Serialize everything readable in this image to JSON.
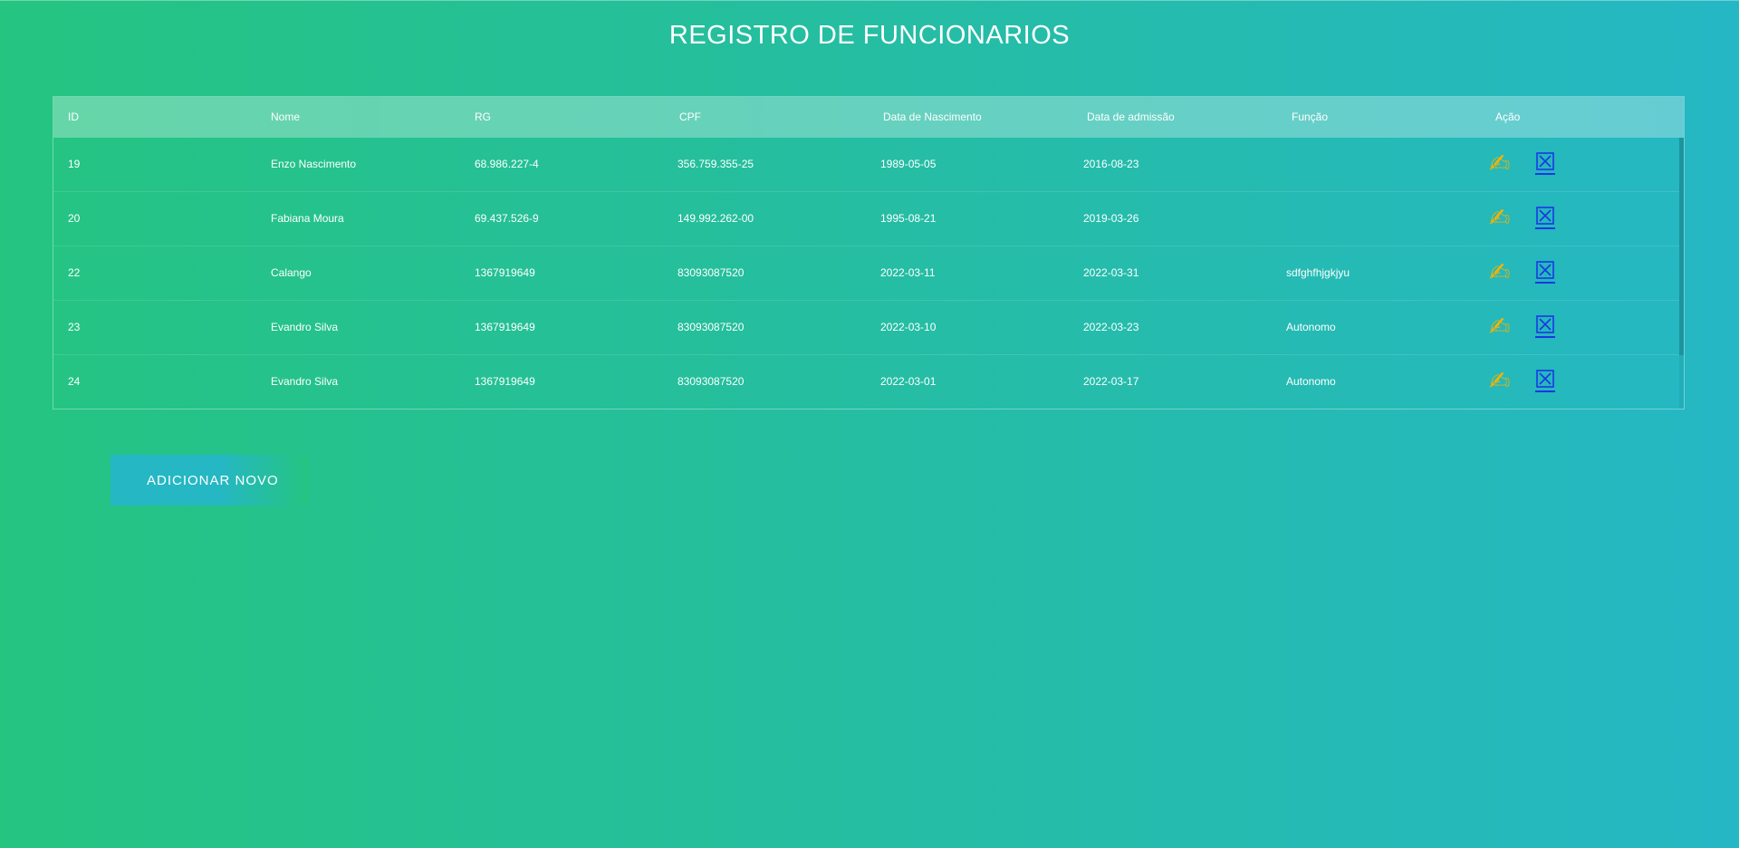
{
  "page": {
    "title": "REGISTRO DE FUNCIONARIOS"
  },
  "table": {
    "headers": [
      "ID",
      "Nome",
      "RG",
      "CPF",
      "Data de Nascimento",
      "Data de admissão",
      "Função",
      "Ação"
    ],
    "rows": [
      [
        "19",
        "Enzo Nascimento",
        "68.986.227-4",
        "356.759.355-25",
        "1989-05-05",
        "2016-08-23",
        ""
      ],
      [
        "20",
        "Fabiana Moura",
        "69.437.526-9",
        "149.992.262-00",
        "1995-08-21",
        "2019-03-26",
        ""
      ],
      [
        "22",
        "Calango",
        "1367919649",
        "83093087520",
        "2022-03-11",
        "2022-03-31",
        "sdfghfhjgkjyu"
      ],
      [
        "23",
        "Evandro Silva",
        "1367919649",
        "83093087520",
        "2022-03-10",
        "2022-03-23",
        "Autonomo"
      ],
      [
        "24",
        "Evandro Silva",
        "1367919649",
        "83093087520",
        "2022-03-01",
        "2022-03-17",
        "Autonomo"
      ]
    ],
    "actions": {
      "edit_icon": "writing-hand-icon",
      "delete_icon": "ballot-x-icon",
      "edit_glyph": "✍",
      "edit_color": "#f5b300",
      "delete_color": "#1a37e6"
    }
  },
  "add_button": {
    "label": "ADICIONAR NOVO"
  },
  "colors": {
    "gradient_start": "#25c481",
    "gradient_end": "#25b7c4"
  }
}
